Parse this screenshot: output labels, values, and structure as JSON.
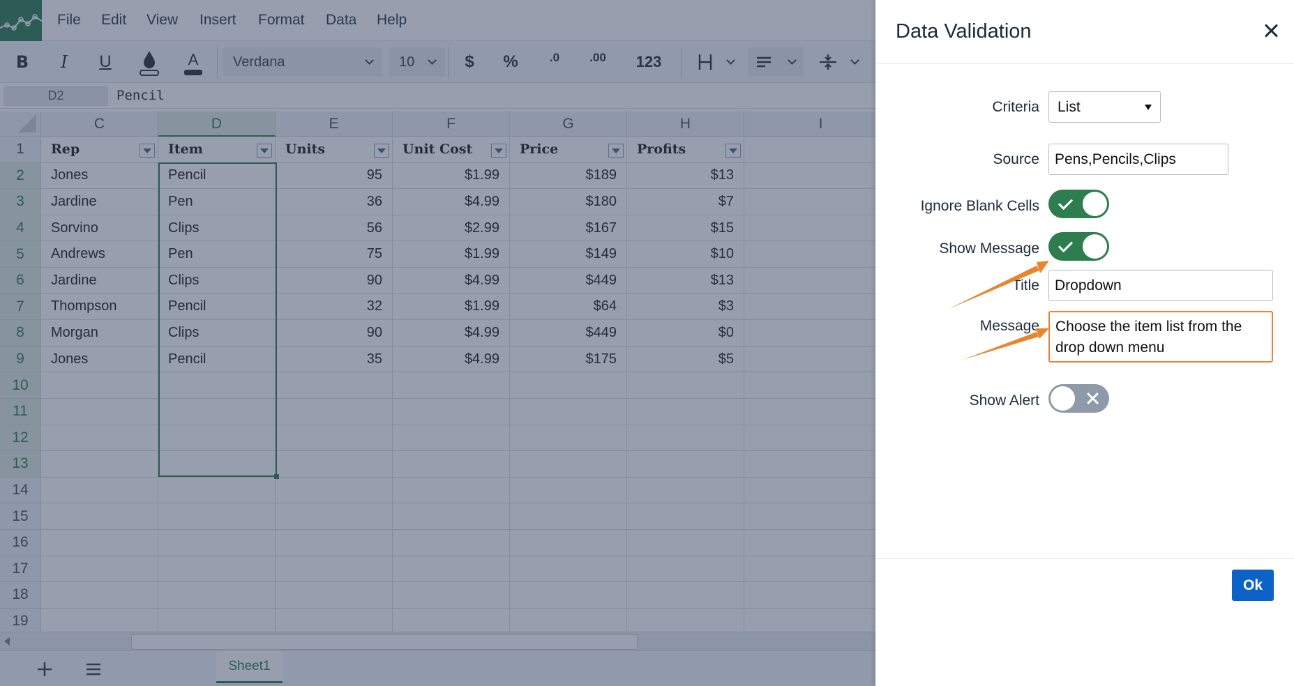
{
  "menubar": {
    "items": [
      "File",
      "Edit",
      "View",
      "Insert",
      "Format",
      "Data",
      "Help"
    ]
  },
  "toolbar": {
    "bold": "B",
    "italic": "I",
    "underline": "U",
    "font_name": "Verdana",
    "font_size": "10",
    "currency": "$",
    "percent": "%",
    "decrease_decimals": ".0",
    "increase_decimals": ".00",
    "number_format": "123"
  },
  "formula_bar": {
    "cell_ref": "D2",
    "value": "Pencil"
  },
  "sheet": {
    "columns": [
      "C",
      "D",
      "E",
      "F",
      "G",
      "H",
      "I"
    ],
    "selected_column": "D",
    "row_numbers": [
      "1",
      "2",
      "3",
      "4",
      "5",
      "6",
      "7",
      "8",
      "9",
      "10",
      "11",
      "12",
      "13",
      "14",
      "15",
      "16",
      "17",
      "18",
      "19"
    ],
    "headers": [
      "Rep",
      "Item",
      "Units",
      "Unit Cost",
      "Price",
      "Profits"
    ],
    "rows": [
      [
        "Jones",
        "Pencil",
        "95",
        "$1.99",
        "$189",
        "$13"
      ],
      [
        "Jardine",
        "Pen",
        "36",
        "$4.99",
        "$180",
        "$7"
      ],
      [
        "Sorvino",
        "Clips",
        "56",
        "$2.99",
        "$167",
        "$15"
      ],
      [
        "Andrews",
        "Pen",
        "75",
        "$1.99",
        "$149",
        "$10"
      ],
      [
        "Jardine",
        "Clips",
        "90",
        "$4.99",
        "$449",
        "$13"
      ],
      [
        "Thompson",
        "Pencil",
        "32",
        "$1.99",
        "$64",
        "$3"
      ],
      [
        "Morgan",
        "Clips",
        "90",
        "$4.99",
        "$449",
        "$0"
      ],
      [
        "Jones",
        "Pencil",
        "35",
        "$4.99",
        "$175",
        "$5"
      ]
    ],
    "tab_name": "Sheet1"
  },
  "dialog": {
    "title": "Data Validation",
    "criteria_label": "Criteria",
    "criteria_value": "List",
    "source_label": "Source",
    "source_value": "Pens,Pencils,Clips",
    "ignore_blank_label": "Ignore Blank Cells",
    "ignore_blank_on": true,
    "show_message_label": "Show Message",
    "show_message_on": true,
    "title_label": "Title",
    "title_value": "Dropdown",
    "message_label": "Message",
    "message_value": "Choose the item list from the drop down menu",
    "show_alert_label": "Show Alert",
    "show_alert_on": false,
    "ok_label": "Ok"
  },
  "colors": {
    "brand_green": "#217346",
    "toggle_on": "#2e7d4f",
    "toggle_off": "#8f9aa8",
    "ok_button": "#0d62c8",
    "highlight": "#e8823a"
  }
}
